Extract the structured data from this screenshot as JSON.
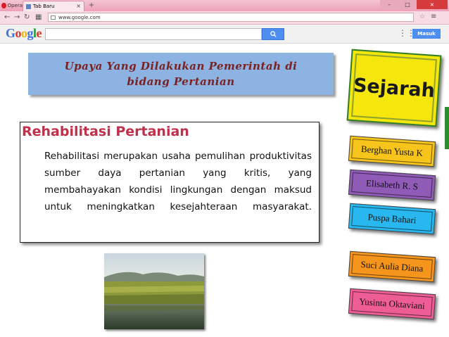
{
  "browser": {
    "opera_label": "Opera",
    "tab_title": "Tab Baru",
    "new_tab": "+",
    "url": "www.google.com",
    "google_logo": "Google",
    "search_button_icon": "search-icon",
    "signin_label": "Masuk",
    "window_controls": [
      "–",
      "□",
      "×"
    ]
  },
  "slide": {
    "title": "Upaya Yang Dilakukan Pemerintah di bidang Pertanian",
    "heading": "Rehabilitasi Pertanian",
    "body": "Rehabilitasi merupakan usaha pemulihan produktivitas sumber daya pertanian yang kritis, yang membahayakan kondisi lingkungan dengan maksud untuk meningkatkan kesejahteraan masyarakat.",
    "menu_title": "Sejarah",
    "members": [
      "Berghan Yusta K",
      "Elisabeth R. S",
      "Puspa Bahari",
      "Suci Aulia Diana",
      "Yusinta Oktaviani"
    ]
  },
  "colors": {
    "title_bg": "#8db3e2",
    "title_text": "#7b2121",
    "heading_text": "#c0304a",
    "sejarah_bg": "#f5e60c",
    "member_colors": [
      "#f7c41b",
      "#8f5bb6",
      "#29b7ef",
      "#f6951c",
      "#ee5d95"
    ]
  }
}
